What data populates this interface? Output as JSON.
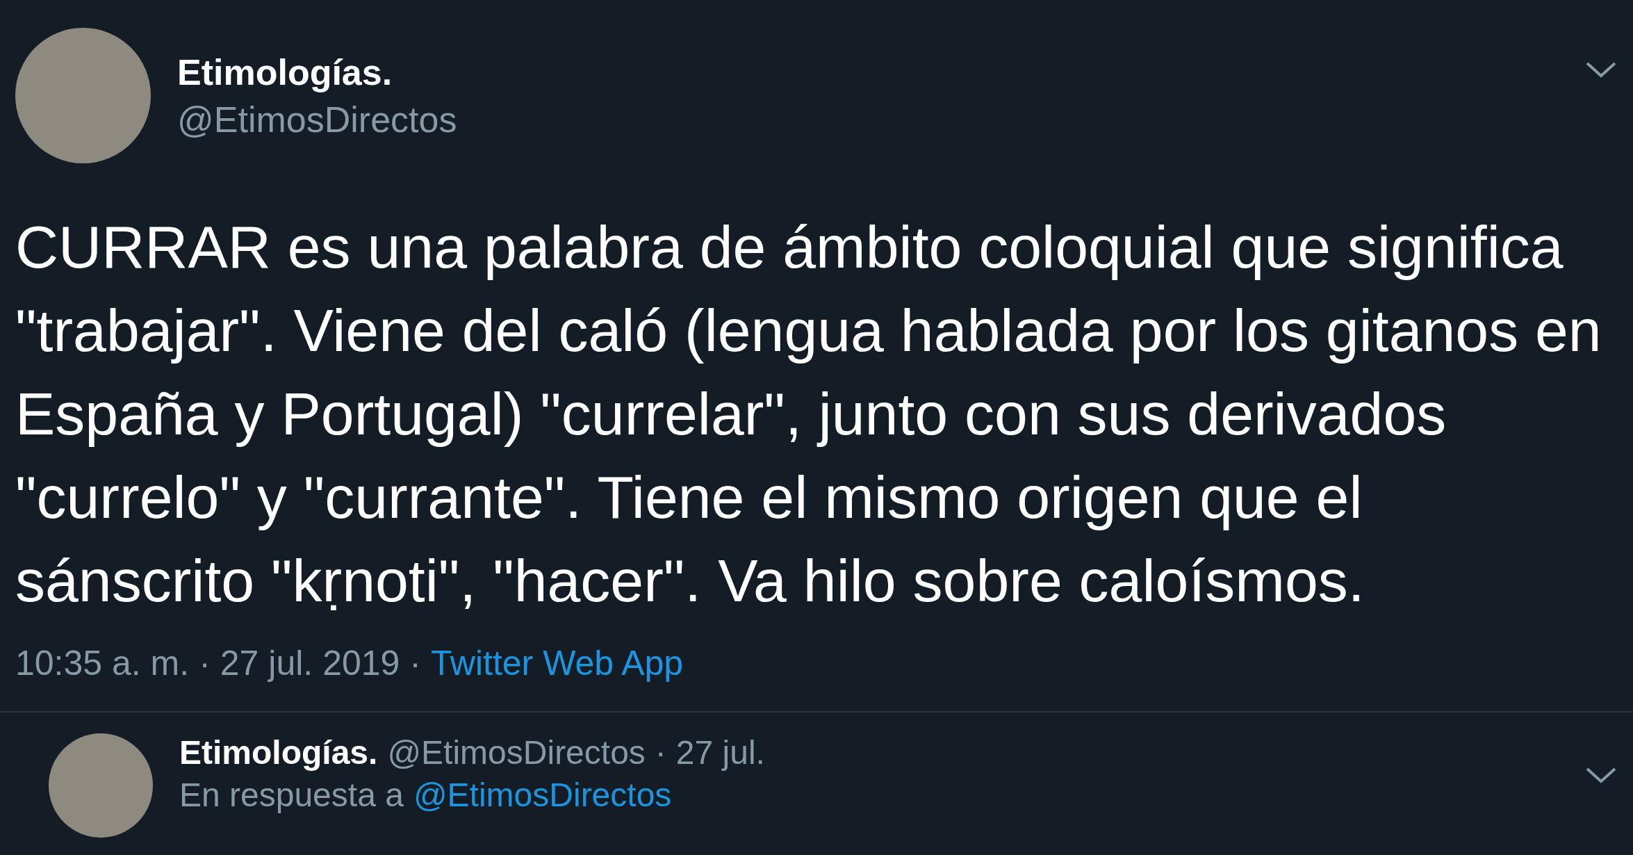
{
  "tweet": {
    "name": "Etimologías.",
    "handle": "@EtimosDirectos",
    "text": "CURRAR es una palabra de ámbito coloquial que significa \"trabajar\". Viene del caló (lengua hablada por los gitanos en España y Portugal) \"currelar\", junto con sus derivados \"currelo\" y \"currante\". Tiene el mismo origen que el sánscrito \"kṛnoti\", \"hacer\". Va hilo sobre caloísmos.",
    "time": "10:35 a. m.",
    "date": "27 jul. 2019",
    "source": "Twitter Web App",
    "separator": "·"
  },
  "reply": {
    "name": "Etimologías.",
    "handle": "@EtimosDirectos",
    "date": "27 jul.",
    "separator": "·",
    "reply_prefix": "En respuesta a",
    "reply_to": "@EtimosDirectos"
  }
}
